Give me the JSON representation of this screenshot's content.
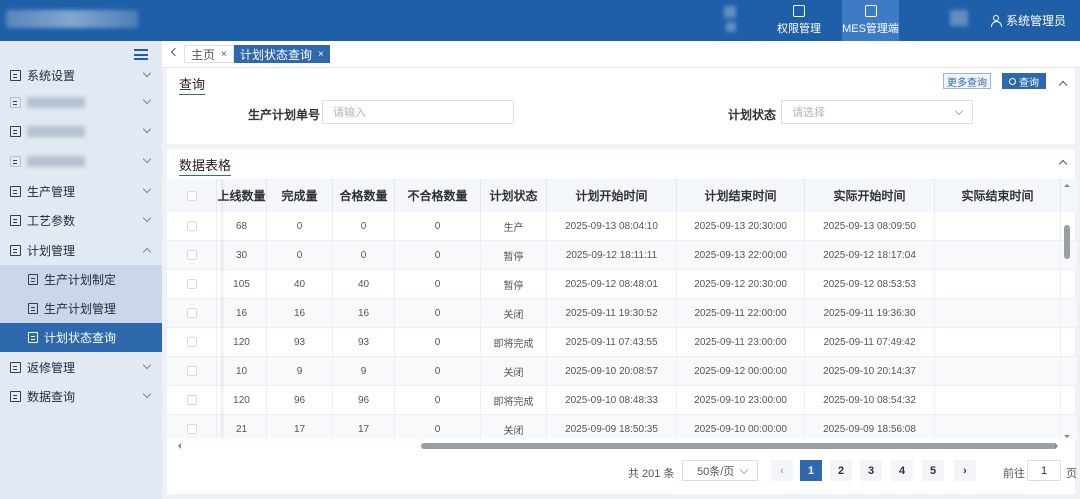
{
  "topbar": {
    "nav": [
      {
        "label": "权限管理",
        "active": false
      },
      {
        "label": "MES管理端",
        "active": true
      }
    ],
    "user": "系统管理员"
  },
  "sidebar": {
    "items": [
      {
        "label": "系统设置",
        "expanded": false
      },
      {
        "label": "",
        "blurred": true
      },
      {
        "label": "",
        "blurred": true
      },
      {
        "label": "",
        "blurred": true
      },
      {
        "label": "生产管理",
        "expanded": false
      },
      {
        "label": "工艺参数",
        "expanded": false
      },
      {
        "label": "计划管理",
        "expanded": true
      },
      {
        "label": "返修管理",
        "expanded": false
      },
      {
        "label": "数据查询",
        "expanded": false
      }
    ],
    "sub_items": [
      {
        "label": "生产计划制定",
        "active": false
      },
      {
        "label": "生产计划管理",
        "active": false
      },
      {
        "label": "计划状态查询",
        "active": true
      }
    ]
  },
  "tabs": {
    "home": "主页",
    "current": "计划状态查询",
    "close": "×"
  },
  "query": {
    "title": "查询",
    "more_label": "更多查询",
    "query_label": "查询",
    "plan_no_label": "生产计划单号",
    "plan_no_placeholder": "请输入",
    "status_label": "计划状态",
    "status_placeholder": "请选择"
  },
  "table": {
    "title": "数据表格",
    "columns": [
      "上线数量",
      "完成量",
      "合格数量",
      "不合格数量",
      "计划状态",
      "计划开始时间",
      "计划结束时间",
      "实际开始时间",
      "实际结束时间"
    ],
    "rows": [
      [
        "68",
        "0",
        "0",
        "0",
        "生产",
        "2025-09-13 08:04:10",
        "2025-09-13 20:30:00",
        "2025-09-13 08:09:50",
        ""
      ],
      [
        "30",
        "0",
        "0",
        "0",
        "暂停",
        "2025-09-12 18:11:11",
        "2025-09-13 22:00:00",
        "2025-09-12 18:17:04",
        ""
      ],
      [
        "105",
        "40",
        "40",
        "0",
        "暂停",
        "2025-09-12 08:48:01",
        "2025-09-12 20:30:00",
        "2025-09-12 08:53:53",
        ""
      ],
      [
        "16",
        "16",
        "16",
        "0",
        "关闭",
        "2025-09-11 19:30:52",
        "2025-09-11 22:00:00",
        "2025-09-11 19:36:30",
        ""
      ],
      [
        "120",
        "93",
        "93",
        "0",
        "即将完成",
        "2025-09-11 07:43:55",
        "2025-09-11 23:00:00",
        "2025-09-11 07:49:42",
        ""
      ],
      [
        "10",
        "9",
        "9",
        "0",
        "关闭",
        "2025-09-10 20:08:57",
        "2025-09-12 00:00:00",
        "2025-09-10 20:14:37",
        ""
      ],
      [
        "120",
        "96",
        "96",
        "0",
        "即将完成",
        "2025-09-10 08:48:33",
        "2025-09-10 23:00:00",
        "2025-09-10 08:54:32",
        ""
      ],
      [
        "21",
        "17",
        "17",
        "0",
        "关闭",
        "2025-09-09 18:50:35",
        "2025-09-10 00:00:00",
        "2025-09-09 18:56:08",
        ""
      ]
    ]
  },
  "pagination": {
    "total": "共 201 条",
    "page_size": "50条/页",
    "pages": [
      "1",
      "2",
      "3",
      "4",
      "5"
    ],
    "current": "1",
    "goto_label": "前往",
    "goto_value": "1",
    "page_suffix": "页",
    "prev": "‹",
    "next": "›"
  },
  "colors": {
    "header_bg": "#1f5fa8",
    "accent": "#2e68ad",
    "sidebar_bg": "#e2e9f2"
  }
}
